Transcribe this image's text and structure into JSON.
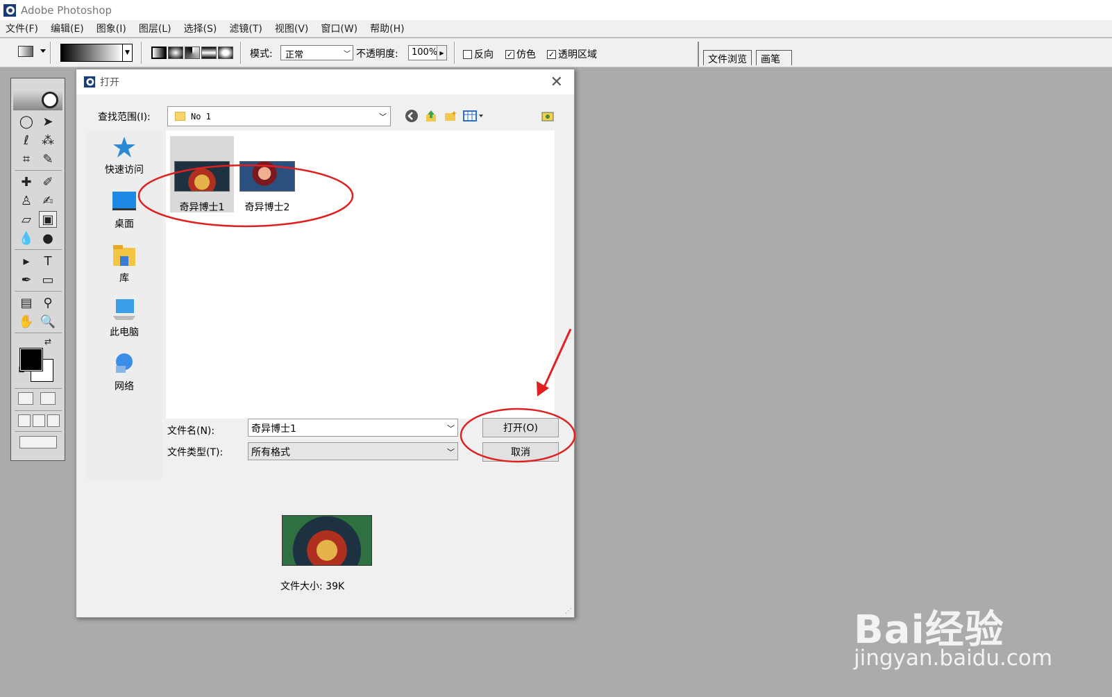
{
  "app": {
    "title": "Adobe Photoshop",
    "menus": [
      "文件(F)",
      "编辑(E)",
      "图象(I)",
      "图层(L)",
      "选择(S)",
      "滤镜(T)",
      "视图(V)",
      "窗口(W)",
      "帮助(H)"
    ]
  },
  "options_bar": {
    "mode_label": "模式:",
    "mode_value": "正常",
    "opacity_label": "不透明度:",
    "opacity_value": "100%",
    "reverse_label": "反向",
    "dither_label": "仿色",
    "transparency_label": "透明区域",
    "reverse_checked": false,
    "dither_checked": true,
    "transparency_checked": true,
    "palette_tabs": [
      "文件浏览",
      "画笔"
    ]
  },
  "dialog": {
    "title": "打开",
    "close_icon": "close-icon",
    "look_in_label": "查找范围(I):",
    "look_in_value": "No 1",
    "places": [
      {
        "label": "快速访问",
        "icon": "quick-access-icon"
      },
      {
        "label": "桌面",
        "icon": "desktop-icon"
      },
      {
        "label": "库",
        "icon": "library-icon"
      },
      {
        "label": "此电脑",
        "icon": "this-pc-icon"
      },
      {
        "label": "网络",
        "icon": "network-icon"
      }
    ],
    "files": [
      {
        "name": "奇异博士1",
        "selected": true
      },
      {
        "name": "奇异博士2",
        "selected": false
      }
    ],
    "file_name_label": "文件名(N):",
    "file_name_value": "奇异博士1",
    "file_type_label": "文件类型(T):",
    "file_type_value": "所有格式",
    "open_button": "打开(O)",
    "cancel_button": "取消",
    "file_size": "文件大小: 39K"
  },
  "watermark": {
    "brand": "Bai经验",
    "url": "jingyan.baidu.com"
  },
  "colors": {
    "workspace": "#ababab",
    "annotation": "#e02020"
  }
}
